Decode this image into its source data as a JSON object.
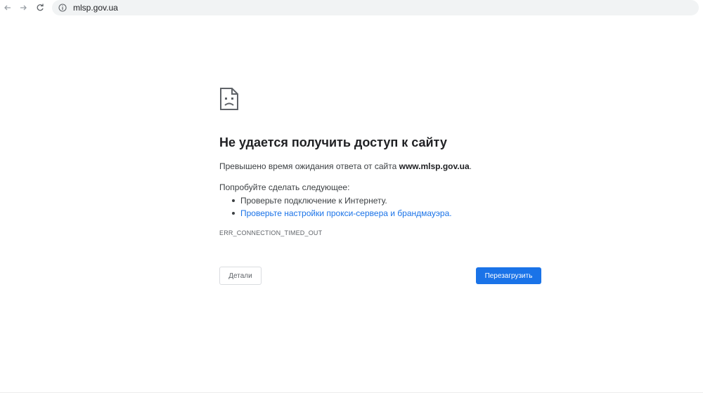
{
  "browser": {
    "url": "mlsp.gov.ua",
    "icons": {
      "back": "arrow-left-icon",
      "forward": "arrow-right-icon",
      "reload": "reload-icon",
      "site_info": "info-circle-icon"
    }
  },
  "error_page": {
    "icon": "sad-page-icon",
    "title": "Не удается получить доступ к сайту",
    "summary_prefix": "Превышено время ожидания ответа от сайта ",
    "summary_host": "www.mlsp.gov.ua",
    "summary_suffix": ".",
    "suggestions_heading": "Попробуйте сделать следующее:",
    "suggestions": [
      "Проверьте подключение к Интернету.",
      "Проверьте настройки прокси-сервера и брандмауэра."
    ],
    "error_code": "ERR_CONNECTION_TIMED_OUT",
    "details_button": "Детали",
    "reload_button": "Перезагрузить"
  },
  "colors": {
    "link": "#1a73e8",
    "primary_button": "#1a73e8",
    "text": "#202124"
  }
}
